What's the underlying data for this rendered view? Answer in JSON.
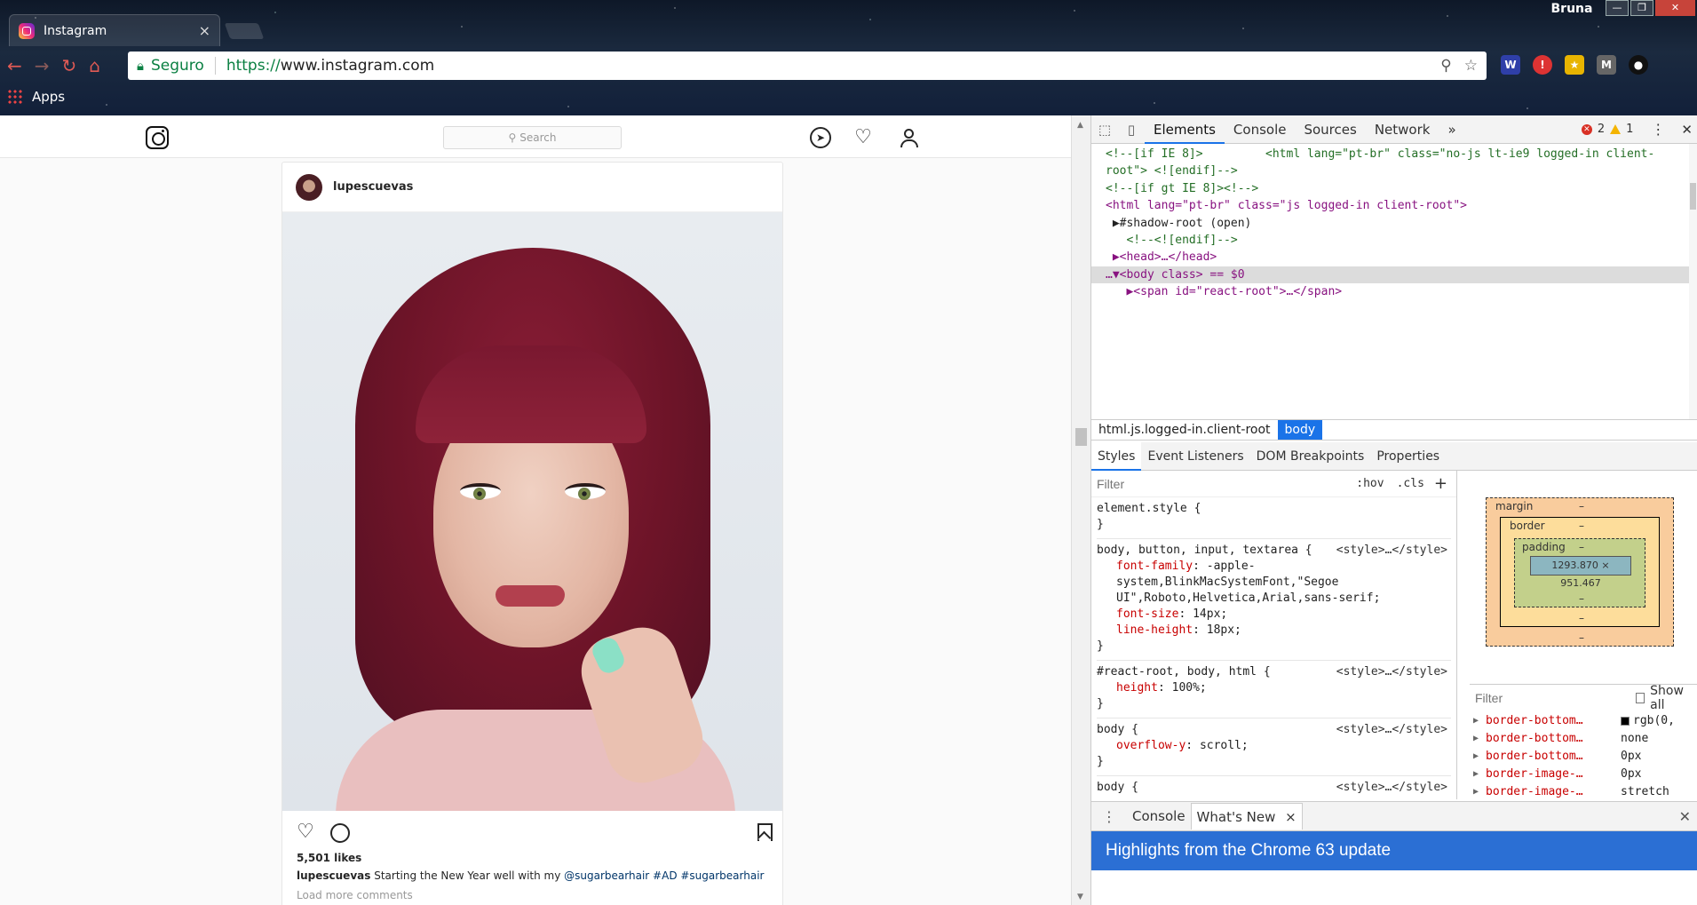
{
  "browser": {
    "tab_title": "Instagram",
    "tab_close": "×",
    "user": "Bruna",
    "win_min": "—",
    "win_max": "❐",
    "win_close": "✕",
    "secure_label": "Seguro",
    "url_protocol": "https://",
    "url_host": "www.instagram.com",
    "bookmarks_apps": "Apps"
  },
  "instagram": {
    "search_placeholder": "Search",
    "post": {
      "username": "lupescuevas",
      "likes": "5,501 likes",
      "caption_user": "lupescuevas",
      "caption_text": " Starting the New Year well with my ",
      "caption_tags": "@sugarbearhair #AD #sugarbearhair",
      "load_more": "Load more comments"
    }
  },
  "devtools": {
    "tabs": [
      "Elements",
      "Console",
      "Sources",
      "Network"
    ],
    "more_tabs": "»",
    "errors": "2",
    "warnings": "1",
    "dom_lines": [
      {
        "text": "<!--[if IE 8]>         <html lang=\"pt-br\" class=\"no-js lt-ie9 logged-in client-",
        "kind": "c"
      },
      {
        "text": "root\"> <![endif]-->",
        "kind": "c"
      },
      {
        "text": "<!--[if gt IE 8]><!-->",
        "kind": "c"
      },
      {
        "text": "<html lang=\"pt-br\" class=\"js logged-in client-root\">",
        "kind": "t"
      },
      {
        "text": " ▶#shadow-root (open)",
        "kind": "plain"
      },
      {
        "text": "   <!--<![endif]-->",
        "kind": "c"
      },
      {
        "text": " ▶<head>…</head>",
        "kind": "t"
      },
      {
        "text": "…▼<body class> == $0",
        "kind": "sel"
      },
      {
        "text": "   ▶<span id=\"react-root\">…</span>",
        "kind": "t"
      }
    ],
    "crumbs": [
      "html.js.logged-in.client-root",
      "body"
    ],
    "sub_tabs": [
      "Styles",
      "Event Listeners",
      "DOM Breakpoints",
      "Properties"
    ],
    "filter_placeholder": "Filter",
    "hov": ":hov",
    "cls": ".cls",
    "plus": "+",
    "rules": [
      {
        "selector": "element.style {",
        "source": "",
        "props": [],
        "close": "}"
      },
      {
        "selector": "body, button, input, textarea {",
        "source": "<style>…</style>",
        "props": [
          {
            "name": "font-family",
            "value": "-apple-system,BlinkMacSystemFont,\"Segoe UI\",Roboto,Helvetica,Arial,sans-serif;"
          },
          {
            "name": "font-size",
            "value": "14px;"
          },
          {
            "name": "line-height",
            "value": "18px;"
          }
        ],
        "close": "}"
      },
      {
        "selector": "#react-root, body, html {",
        "source": "<style>…</style>",
        "props": [
          {
            "name": "height",
            "value": "100%;"
          }
        ],
        "close": "}"
      },
      {
        "selector": "body {",
        "source": "<style>…</style>",
        "props": [
          {
            "name": "overflow-y",
            "value": "scroll;"
          }
        ],
        "close": "}"
      },
      {
        "selector": "body {",
        "source": "<style>…</style>",
        "props": [],
        "close": ""
      }
    ],
    "box_model": {
      "margin": "margin",
      "border": "border",
      "padding": "padding",
      "dash": "–",
      "content": "1293.870 × 951.467"
    },
    "computed_filter": "Filter",
    "show_all": "Show all",
    "computed": [
      {
        "name": "border-bottom…",
        "value": "rgb(0,",
        "swatch": true
      },
      {
        "name": "border-bottom…",
        "value": "none",
        "swatch": false
      },
      {
        "name": "border-bottom…",
        "value": "0px",
        "swatch": false
      },
      {
        "name": "border-image-…",
        "value": "0px",
        "swatch": false
      },
      {
        "name": "border-image-…",
        "value": "stretch",
        "swatch": false
      }
    ],
    "drawer_tabs": [
      "Console",
      "What's New"
    ],
    "drawer_tab_close": "×",
    "drawer_close": "✕",
    "whats_new_title": "Highlights from the Chrome 63 update"
  }
}
